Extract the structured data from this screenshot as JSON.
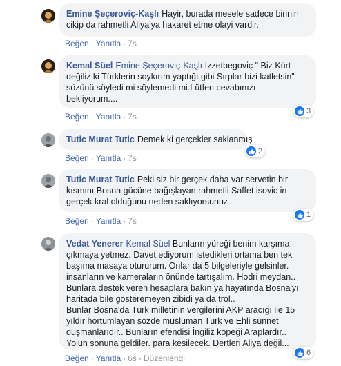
{
  "actions": {
    "like": "Beğen",
    "reply": "Yanıtla",
    "dot": "·"
  },
  "comments": [
    {
      "author": "Emine Şeçeroviç-Kaşlı",
      "lines": [
        "Hayir, burada mesele sadece birinin",
        "cikip da rahmetli Aliya'ya hakaret etme olayi vardir."
      ],
      "time": "7s"
    },
    {
      "author": "Kemal Süel",
      "mention": "Emine Şeçeroviç-Kaşlı",
      "lines": [
        "İzzetbegoviç \" Biz Kürt",
        "değiliz ki Türklerin soykırım yaptığı gibi Sırplar bizi katletsin\"",
        "sözünü söyledi mi söylemedi mi.Lütfen cevabınızı",
        "bekliyorum...."
      ],
      "time": "7s",
      "reactions": "3"
    },
    {
      "author": "Tutic Murat Tutic",
      "lines": [
        "Demek ki gerçekler saklanmış"
      ],
      "time": "7s",
      "reactions": "2"
    },
    {
      "author": "Tutic Murat Tutic",
      "lines": [
        "Peki siz bir gerçek daha var servetin bir",
        "kısmını Bosna gücüne bağışlayan rahmetli Saffet isovic in",
        "gerçek kral olduğunu neden saklıyorsunuz"
      ],
      "time": "7s",
      "reactions": "1"
    },
    {
      "author": "Vedat Yenerer",
      "mention": "Kemal Süel",
      "lines": [
        "Bunların yüreği benim karşıma",
        "çıkmaya yetmez. Davet ediyorum istedikleri ortama ben tek",
        "başıma masaya otururum. Onlar da 5 bilgeleriyle gelsinler.",
        "insanların ve kameraların önünde tartışalım. Hodri meydan..",
        "Bunlara destek veren hesaplara bakın ya hayatında Bosna'yı",
        "haritada bile gösteremeyen zibidi ya da trol..",
        "Bunlar Bosna'da Türk milletinin vergilerini AKP aracığı ile 15",
        "yıldır hortumlayan sözde müslüman Türk ve Ehli sünnet",
        "düşmanlarıdır.. Bunların efendisi İngiliz köpeği Araplardır..",
        "Yolun sonuna geldiler. para kesilecek. Dertleri Aliya değil..."
      ],
      "time": "6s",
      "edited": "Düzenlendi",
      "reactions": "6"
    }
  ],
  "colors": {
    "author": "#385898",
    "action": "#4267b2",
    "bubble": "#f2f3f5",
    "like": "#1877f2"
  },
  "icons": {
    "like": "thumbs-up-icon"
  }
}
